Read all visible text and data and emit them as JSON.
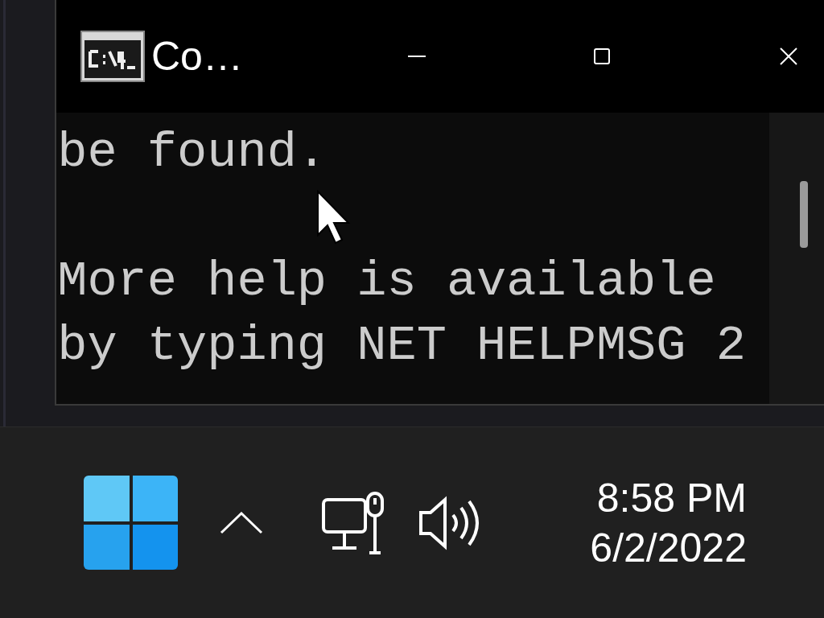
{
  "window": {
    "title": "Co…"
  },
  "console": {
    "paragraphs": [
      [
        " be found."
      ],
      [
        " More help is available",
        " by typing NET HELPMSG 2"
      ]
    ]
  },
  "taskbar": {
    "time": "8:58 PM",
    "date": "6/2/2022"
  }
}
